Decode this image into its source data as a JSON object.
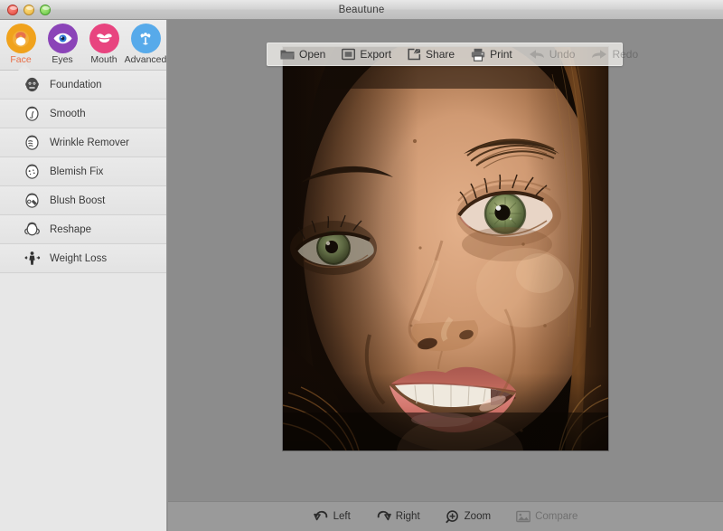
{
  "window": {
    "title": "Beautune",
    "controls": [
      {
        "name": "close-button",
        "color": "#e0483c"
      },
      {
        "name": "minimize-button",
        "color": "#e8b33c"
      },
      {
        "name": "zoom-button",
        "color": "#5ec33f"
      }
    ]
  },
  "sidebar": {
    "tabs": [
      {
        "label": "Face",
        "icon": "face-icon",
        "color": "#f0a21c",
        "active": true
      },
      {
        "label": "Eyes",
        "icon": "eye-icon",
        "color": "#8b44b8",
        "active": false
      },
      {
        "label": "Mouth",
        "icon": "lips-icon",
        "color": "#e8447f",
        "active": false
      },
      {
        "label": "Advanced",
        "icon": "flower-icon",
        "color": "#57aaea",
        "active": false
      }
    ],
    "tools": [
      {
        "label": "Foundation",
        "icon": "foundation-face-icon"
      },
      {
        "label": "Smooth",
        "icon": "smooth-face-icon"
      },
      {
        "label": "Wrinkle Remover",
        "icon": "wrinkle-face-icon"
      },
      {
        "label": "Blemish Fix",
        "icon": "blemish-face-icon"
      },
      {
        "label": "Blush Boost",
        "icon": "blush-face-icon"
      },
      {
        "label": "Reshape",
        "icon": "reshape-face-icon"
      },
      {
        "label": "Weight Loss",
        "icon": "weight-loss-icon"
      }
    ]
  },
  "photo_toolbar": {
    "buttons": [
      {
        "label": "Open",
        "icon": "folder-icon",
        "enabled": true
      },
      {
        "label": "Export",
        "icon": "export-icon",
        "enabled": true
      },
      {
        "label": "Share",
        "icon": "share-icon",
        "enabled": true
      },
      {
        "label": "Print",
        "icon": "printer-icon",
        "enabled": true
      },
      {
        "label": "Undo",
        "icon": "undo-arrow-icon",
        "enabled": false
      },
      {
        "label": "Redo",
        "icon": "redo-arrow-icon",
        "enabled": false
      }
    ]
  },
  "bottom_bar": {
    "buttons": [
      {
        "label": "Left",
        "icon": "rotate-left-icon",
        "enabled": true
      },
      {
        "label": "Right",
        "icon": "rotate-right-icon",
        "enabled": true
      },
      {
        "label": "Zoom",
        "icon": "zoom-plus-icon",
        "enabled": true
      },
      {
        "label": "Compare",
        "icon": "compare-image-icon",
        "enabled": false
      }
    ]
  },
  "canvas": {
    "image_description": "close-up portrait photograph of a smiling woman with green eyes and brown hair",
    "background_color": "#8c8c8c"
  }
}
